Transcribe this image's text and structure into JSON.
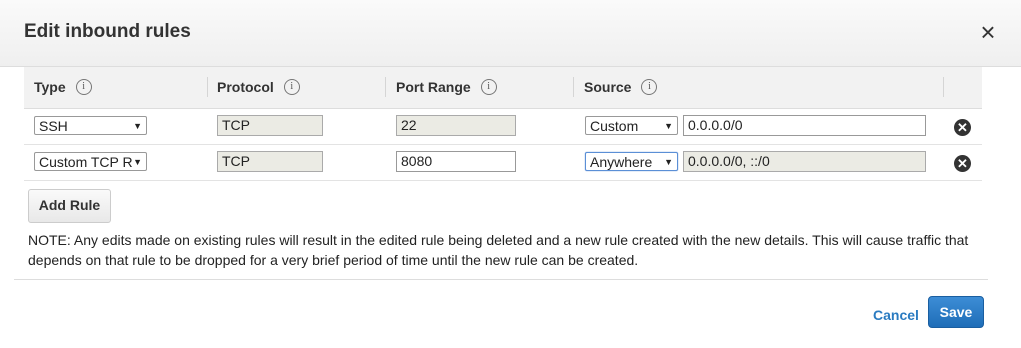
{
  "dialog": {
    "title": "Edit inbound rules",
    "close_label": "×"
  },
  "table": {
    "columns": [
      "Type",
      "Protocol",
      "Port Range",
      "Source"
    ],
    "info_glyph": "i",
    "rows": [
      {
        "type": "SSH",
        "protocol": "TCP",
        "port_range": "22",
        "source_mode": "Custom",
        "source_value": "0.0.0.0/0"
      },
      {
        "type": "Custom TCP R",
        "protocol": "TCP",
        "port_range": "8080",
        "source_mode": "Anywhere",
        "source_value": "0.0.0.0/0, ::/0"
      }
    ]
  },
  "add_rule_label": "Add Rule",
  "note": "NOTE: Any edits made on existing rules will result in the edited rule being deleted and a new rule created with the new details. This will cause traffic that depends on that rule to be dropped for a very brief period of time until the new rule can be created.",
  "footer": {
    "cancel_label": "Cancel",
    "save_label": "Save"
  },
  "colors": {
    "primary": "#2a7bc1",
    "header_bg": "#f2f2f2"
  },
  "icons": {
    "close": "close-icon",
    "info": "info-icon",
    "remove": "remove-icon",
    "dropdown": "chevron-down-icon"
  }
}
